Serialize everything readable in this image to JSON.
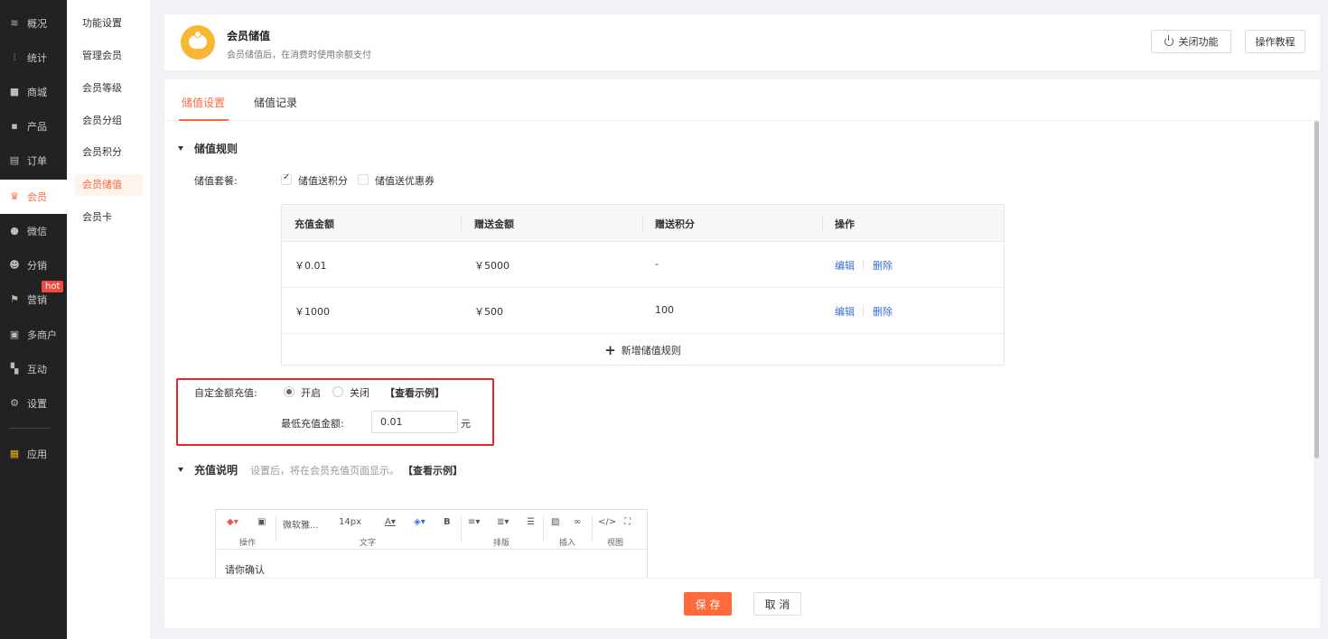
{
  "nav": {
    "items": [
      {
        "label": "概况",
        "icon": "layers-icon"
      },
      {
        "label": "统计",
        "icon": "chart-icon"
      },
      {
        "label": "商城",
        "icon": "store-icon"
      },
      {
        "label": "产品",
        "icon": "grid-icon"
      },
      {
        "label": "订单",
        "icon": "clipboard-icon"
      },
      {
        "label": "会员",
        "icon": "crown-icon"
      },
      {
        "label": "微信",
        "icon": "wechat-icon"
      },
      {
        "label": "分销",
        "icon": "users-icon"
      },
      {
        "label": "营销",
        "icon": "flag-icon"
      },
      {
        "label": "多商户",
        "icon": "shops-icon"
      },
      {
        "label": "互动",
        "icon": "interact-icon"
      },
      {
        "label": "设置",
        "icon": "gear-icon"
      },
      {
        "label": "应用",
        "icon": "apps-icon"
      }
    ],
    "hot_badge": "hot"
  },
  "subnav": {
    "items": [
      "功能设置",
      "管理会员",
      "会员等级",
      "会员分组",
      "会员积分",
      "会员储值",
      "会员卡"
    ]
  },
  "header": {
    "title": "会员储值",
    "subtitle": "会员储值后，在消费时使用余额支付",
    "close_func_label": "关闭功能",
    "tutorial_label": "操作教程"
  },
  "tabs": [
    "储值设置",
    "储值记录"
  ],
  "rules": {
    "section_title": "储值规则",
    "package_label": "储值套餐:",
    "option_points": "储值送积分",
    "option_coupon": "储值送优惠券",
    "table": {
      "headers": [
        "充值金额",
        "赠送金额",
        "赠送积分",
        "操作"
      ],
      "rows": [
        {
          "amount": "￥0.01",
          "bonus": "￥5000",
          "points": "-",
          "edit": "编辑",
          "delete": "删除"
        },
        {
          "amount": "￥1000",
          "bonus": "￥500",
          "points": "100",
          "edit": "编辑",
          "delete": "删除"
        }
      ],
      "add_label": "新增储值规则"
    }
  },
  "custom": {
    "label": "自定金额充值:",
    "on_label": "开启",
    "off_label": "关闭",
    "example_link": "【查看示例】",
    "min_label": "最低充值金额:",
    "min_value": "0.01",
    "unit": "元"
  },
  "desc": {
    "section_title": "充值说明",
    "hint": "设置后，将在会员充值页面显示。",
    "example_link": "【查看示例】"
  },
  "editor": {
    "font_family": "微软雅...",
    "font_size": "14px",
    "groups": [
      "操作",
      "文字",
      "排版",
      "插入",
      "视图"
    ],
    "content": "请你确认"
  },
  "footer": {
    "save_label": "保 存",
    "cancel_label": "取 消"
  },
  "colors": {
    "accent": "#ff6a3d",
    "link": "#3b6fd4",
    "highlight": "#e8262a"
  }
}
